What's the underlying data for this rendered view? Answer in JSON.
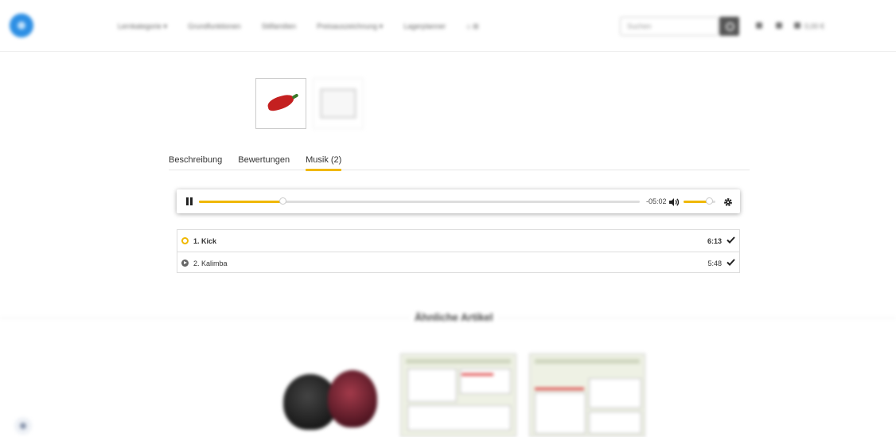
{
  "header": {
    "nav": [
      "Lernkategorie ▾",
      "Grundfunktionen",
      "Stilfamilien",
      "Preisauszeichnung ▾",
      "Lagerplanner",
      "⌂ ⊞"
    ],
    "search_placeholder": "Suchen",
    "cart_label": "0,00 €"
  },
  "tabs": [
    {
      "label": "Beschreibung"
    },
    {
      "label": "Bewertungen"
    },
    {
      "label": "Musik (2)",
      "active": true
    }
  ],
  "player": {
    "progress": 0.19,
    "time_remaining": "-05:02",
    "volume": 0.8
  },
  "playlist": [
    {
      "title": "1. Kick",
      "duration": "6:13",
      "current": true
    },
    {
      "title": "2. Kalimba",
      "duration": "5:48",
      "current": false
    }
  ],
  "similar": {
    "title": "Ähnliche Artikel"
  },
  "colors": {
    "accent": "#f0b800",
    "logo": "#2d8fe4"
  }
}
